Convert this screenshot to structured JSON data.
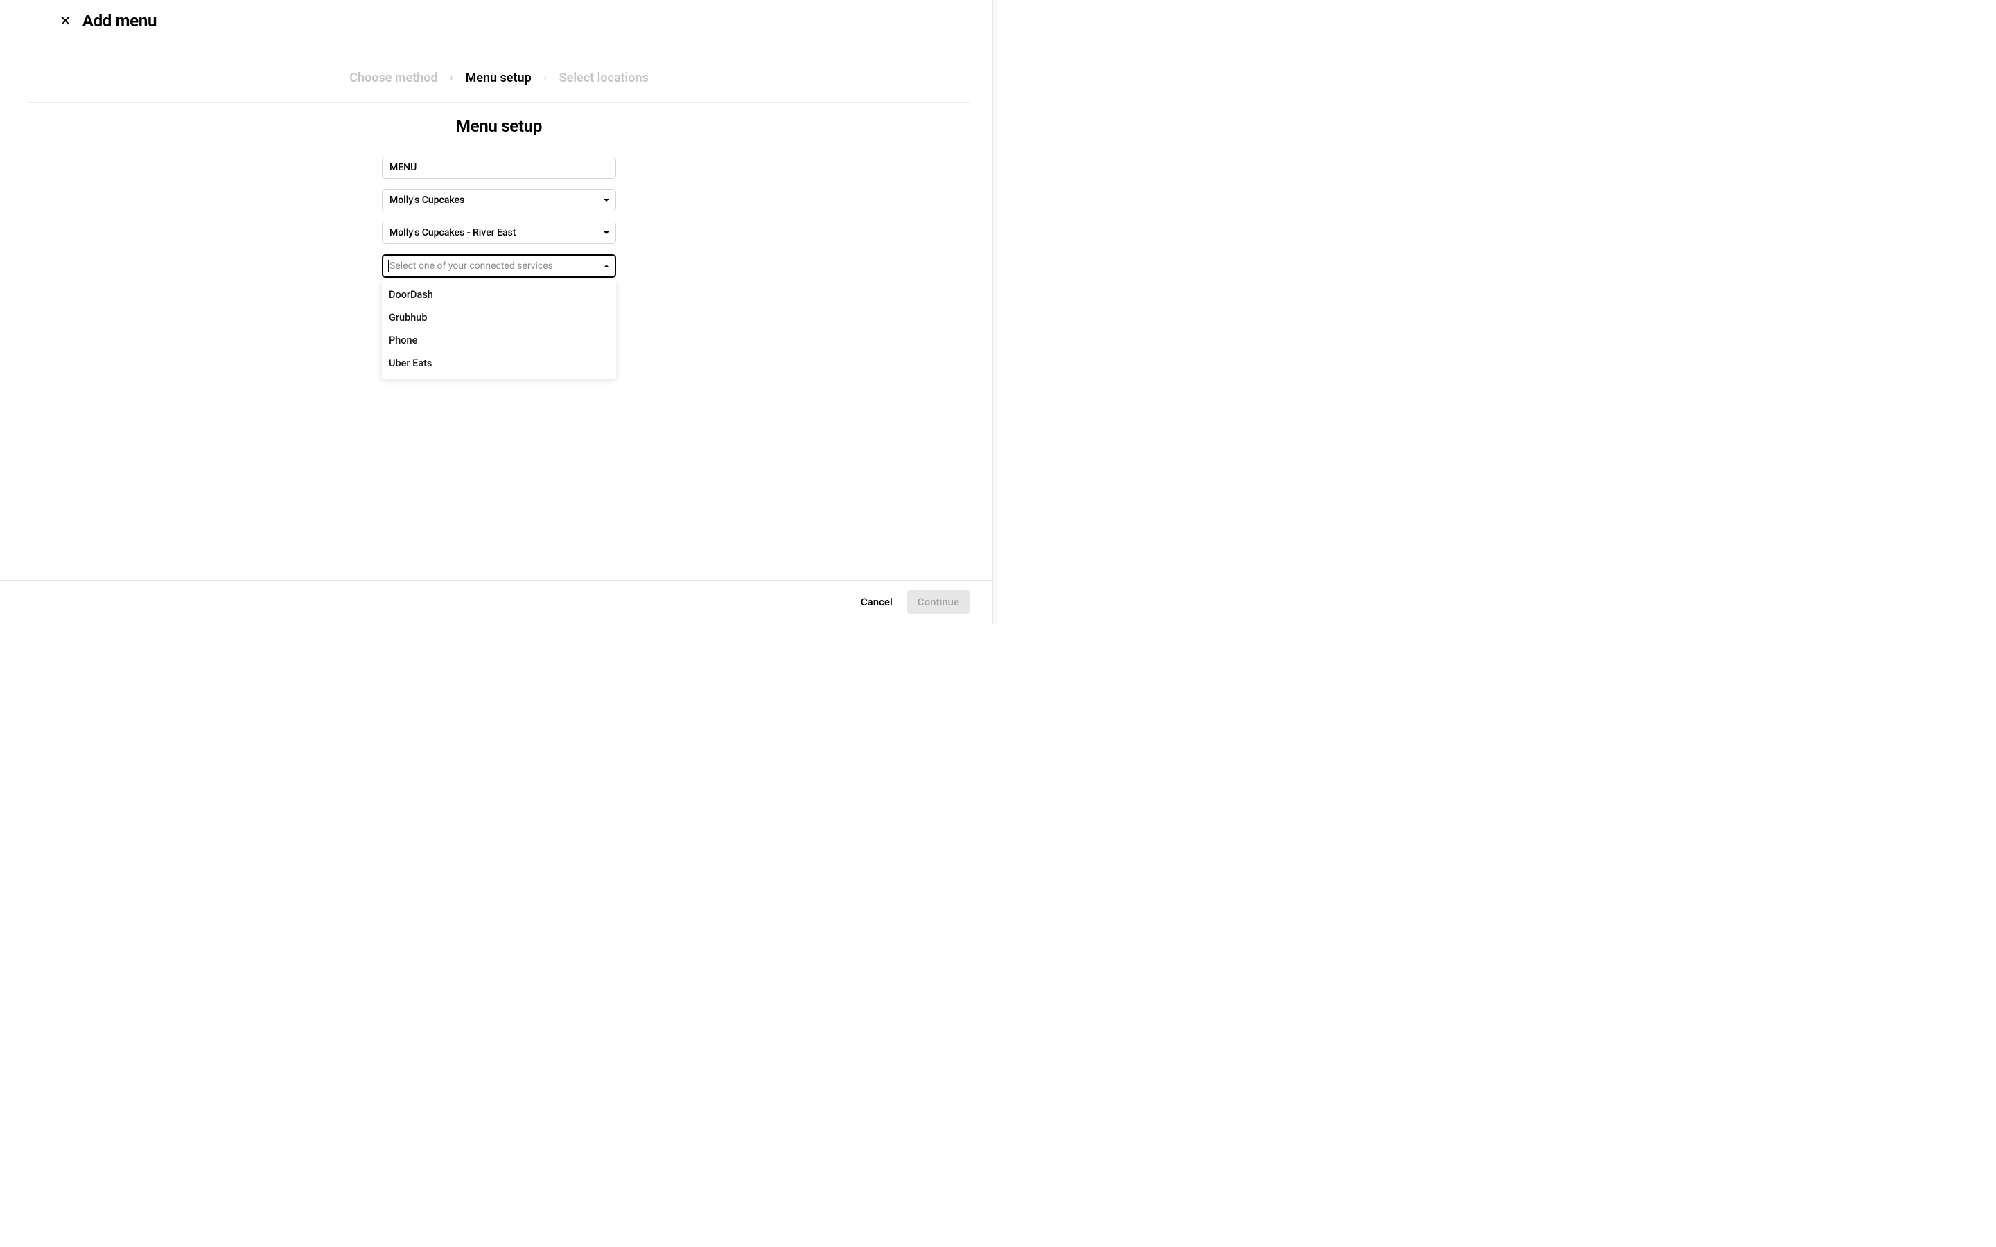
{
  "header": {
    "title": "Add menu"
  },
  "breadcrumb": {
    "steps": [
      {
        "label": "Choose method",
        "active": false
      },
      {
        "label": "Menu setup",
        "active": true
      },
      {
        "label": "Select locations",
        "active": false
      }
    ]
  },
  "section": {
    "title": "Menu setup"
  },
  "form": {
    "menu_name": "MENU",
    "brand": "Molly's Cupcakes",
    "location": "Molly's Cupcakes - River East",
    "service_placeholder": "Select one of your connected services",
    "service_options": [
      "DoorDash",
      "Grubhub",
      "Phone",
      "Uber Eats"
    ]
  },
  "footer": {
    "cancel": "Cancel",
    "continue": "Continue"
  }
}
